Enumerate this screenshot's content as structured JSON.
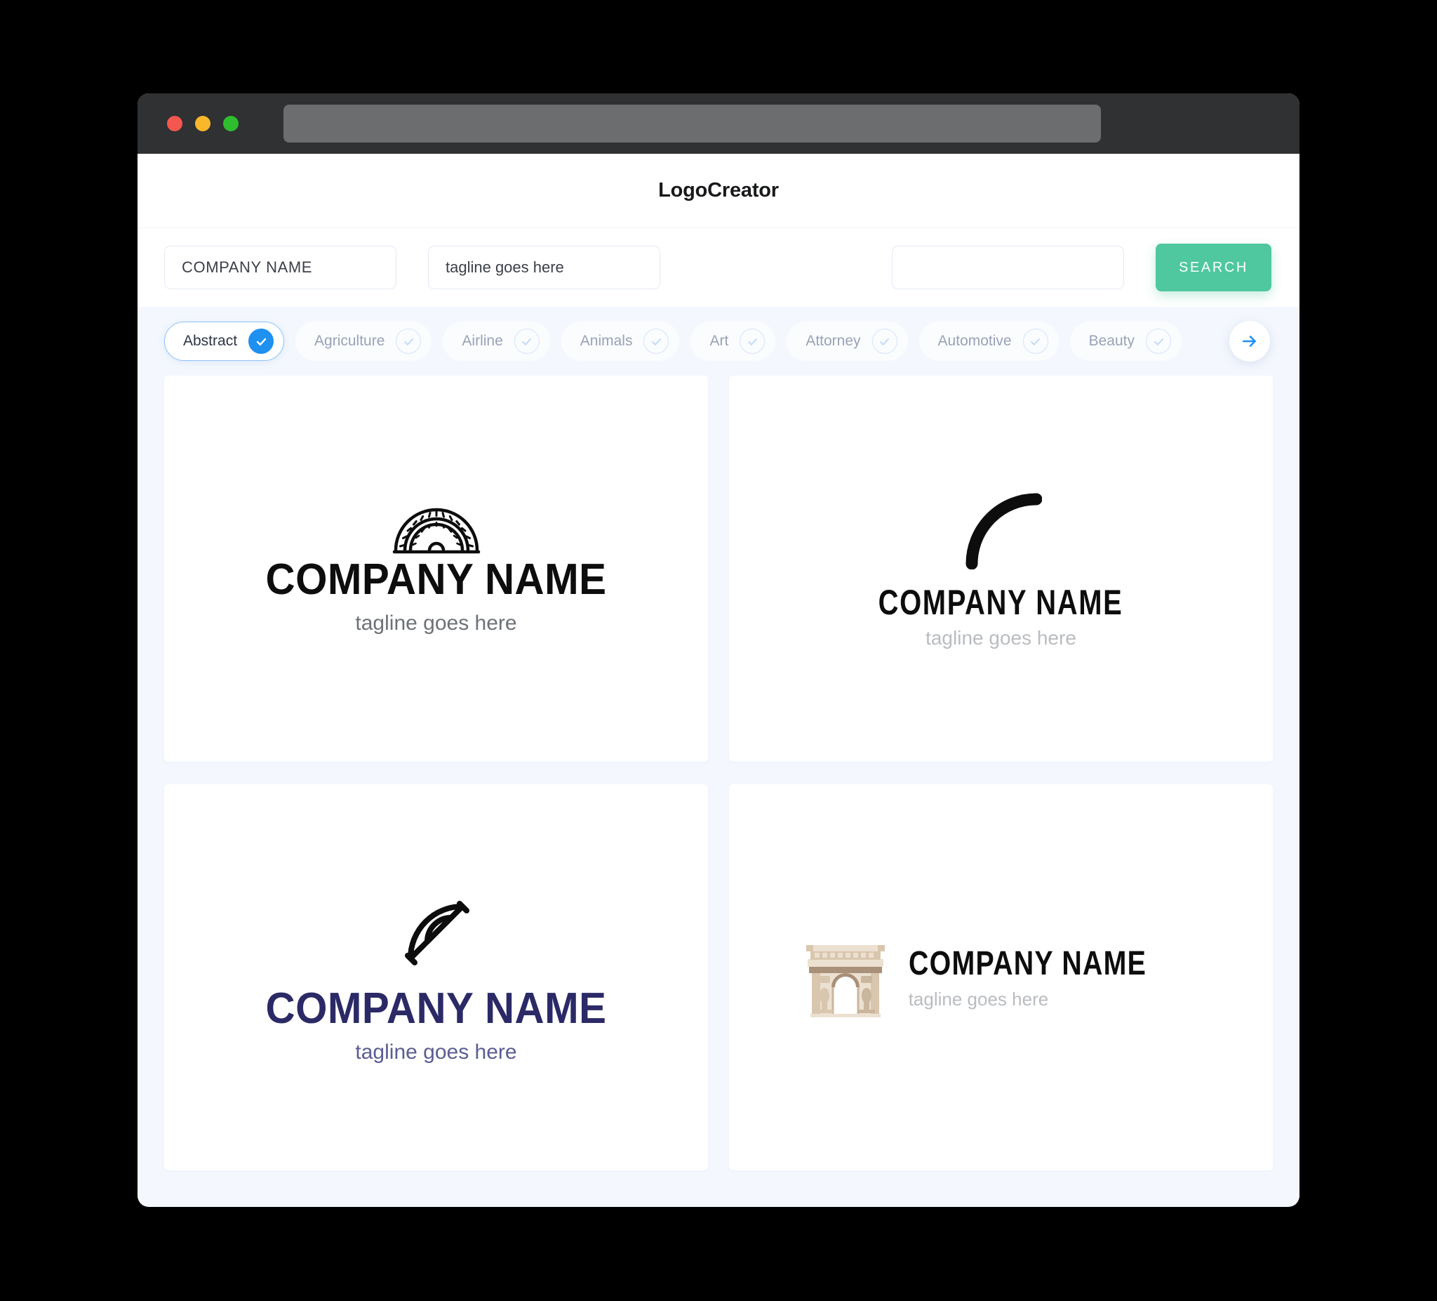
{
  "window": {
    "traffic_lights": [
      "close",
      "minimize",
      "maximize"
    ],
    "colors": {
      "close": "#f4574f",
      "minimize": "#f9b72b",
      "maximize": "#2ebd2e",
      "titlebar": "#2f3133",
      "urlbar": "#6b6d6f"
    },
    "url_value": ""
  },
  "header": {
    "title": "LogoCreator"
  },
  "search": {
    "company_value": "COMPANY NAME",
    "company_placeholder": "COMPANY NAME",
    "tagline_value": "tagline goes here",
    "tagline_placeholder": "tagline goes here",
    "extra_value": "",
    "extra_placeholder": "",
    "button_label": "SEARCH",
    "button_color": "#4fc79f"
  },
  "categories": {
    "accent_color": "#1e90f0",
    "next_icon": "arrow-right-icon",
    "items": [
      {
        "label": "Abstract",
        "selected": true
      },
      {
        "label": "Agriculture",
        "selected": false
      },
      {
        "label": "Airline",
        "selected": false
      },
      {
        "label": "Animals",
        "selected": false
      },
      {
        "label": "Art",
        "selected": false
      },
      {
        "label": "Attorney",
        "selected": false
      },
      {
        "label": "Automotive",
        "selected": false
      },
      {
        "label": "Beauty",
        "selected": false
      }
    ]
  },
  "results": [
    {
      "icon": "protractor-icon",
      "name": "COMPANY NAME",
      "tagline": "tagline goes here",
      "layout": "vertical",
      "name_color": "#0d0d0d",
      "tagline_color": "#6d7278"
    },
    {
      "icon": "arc-stroke-icon",
      "name": "COMPANY NAME",
      "tagline": "tagline goes here",
      "layout": "vertical",
      "name_color": "#0d0d0d",
      "tagline_color": "#b9bcc0"
    },
    {
      "icon": "quarter-protractor-icon",
      "name": "COMPANY NAME",
      "tagline": "tagline goes here",
      "layout": "vertical",
      "name_color": "#2b2a66",
      "tagline_color": "#5b5d92"
    },
    {
      "icon": "arc-de-triomphe-icon",
      "name": "COMPANY NAME",
      "tagline": "tagline goes here",
      "layout": "horizontal",
      "name_color": "#0d0d0d",
      "tagline_color": "#b9bcc0"
    }
  ]
}
